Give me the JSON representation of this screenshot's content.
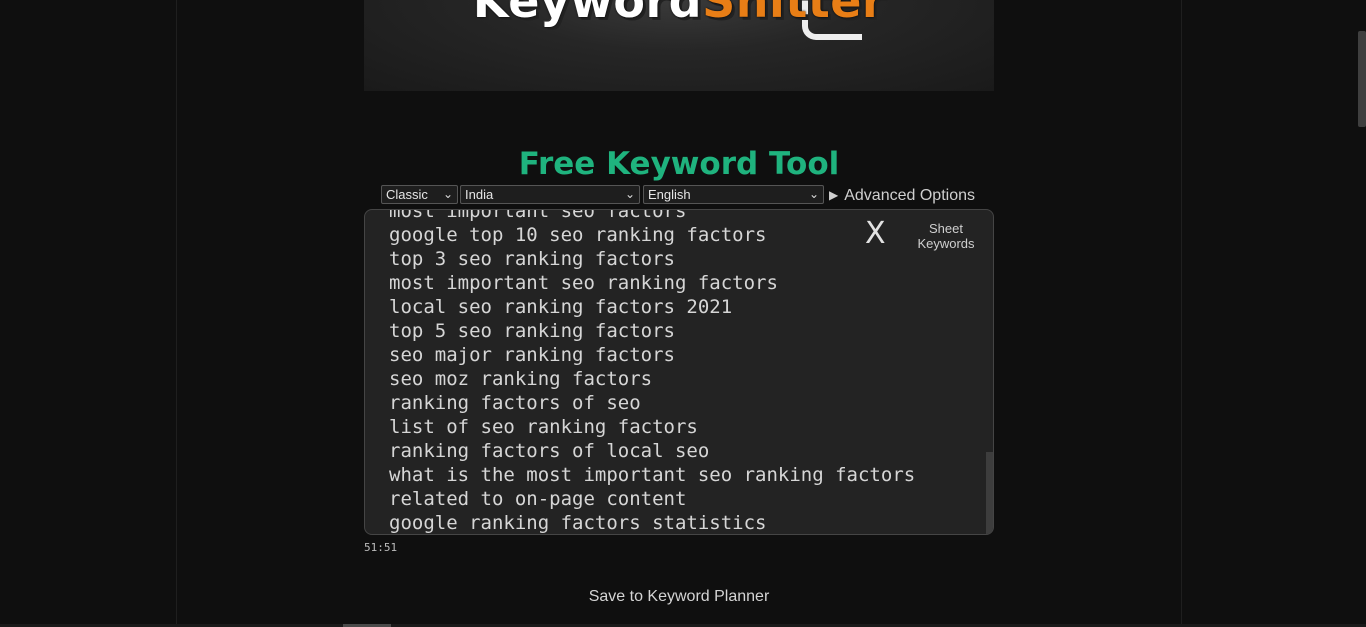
{
  "logo": {
    "word1": "Keyword",
    "word2": "Shitter"
  },
  "title": "Free Keyword Tool",
  "controls": {
    "mode": "Classic",
    "country": "India",
    "language": "English",
    "advanced_label": "Advanced Options"
  },
  "textarea": {
    "clear_label": "X",
    "sheet_line1": "Sheet",
    "sheet_line2": "Keywords",
    "keywords": [
      "most important seo factors",
      "google top 10 seo ranking factors",
      "top 3 seo ranking factors",
      "most important seo ranking factors",
      "local seo ranking factors 2021",
      "top 5 seo ranking factors",
      "seo major ranking factors",
      "seo moz ranking factors",
      "ranking factors of seo",
      "list of seo ranking factors",
      "ranking factors of local seo",
      "what is the most important seo ranking factors",
      "related to on-page content",
      "google ranking factors statistics"
    ]
  },
  "counter": "51:51",
  "save_label": "Save to Keyword Planner",
  "colors": {
    "title": "#1fb37e",
    "logo_accent": "#e87e16"
  },
  "icons": [
    "chevron-down-icon",
    "triangle-right-icon",
    "close-icon"
  ]
}
